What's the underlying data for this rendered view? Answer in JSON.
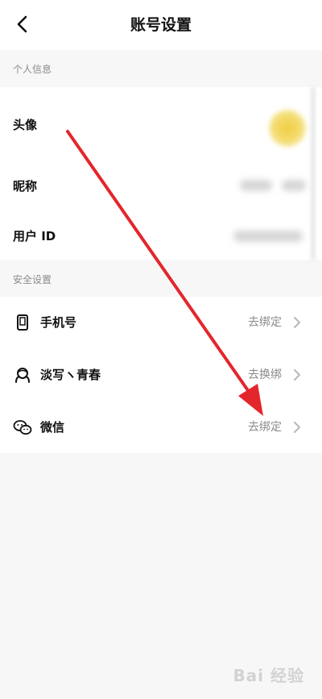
{
  "header": {
    "title": "账号设置",
    "back_icon": "chevron-left-icon"
  },
  "personal_info": {
    "section_label": "个人信息",
    "rows": [
      {
        "label": "头像"
      },
      {
        "label": "昵称"
      },
      {
        "label": "用户 ID"
      }
    ]
  },
  "security": {
    "section_label": "安全设置",
    "rows": [
      {
        "label": "手机号",
        "action": "去绑定",
        "icon": "phone-icon"
      },
      {
        "label": "淡写ヽ青春",
        "action": "去换绑",
        "icon": "account-icon"
      },
      {
        "label": "微信",
        "action": "去绑定",
        "icon": "wechat-icon"
      }
    ]
  },
  "watermark": "Bai 经验",
  "colors": {
    "accent_arrow": "#e3262c",
    "avatar": "#f0cf45",
    "muted_text": "#8a8a8a",
    "background": "#f7f7f8"
  }
}
